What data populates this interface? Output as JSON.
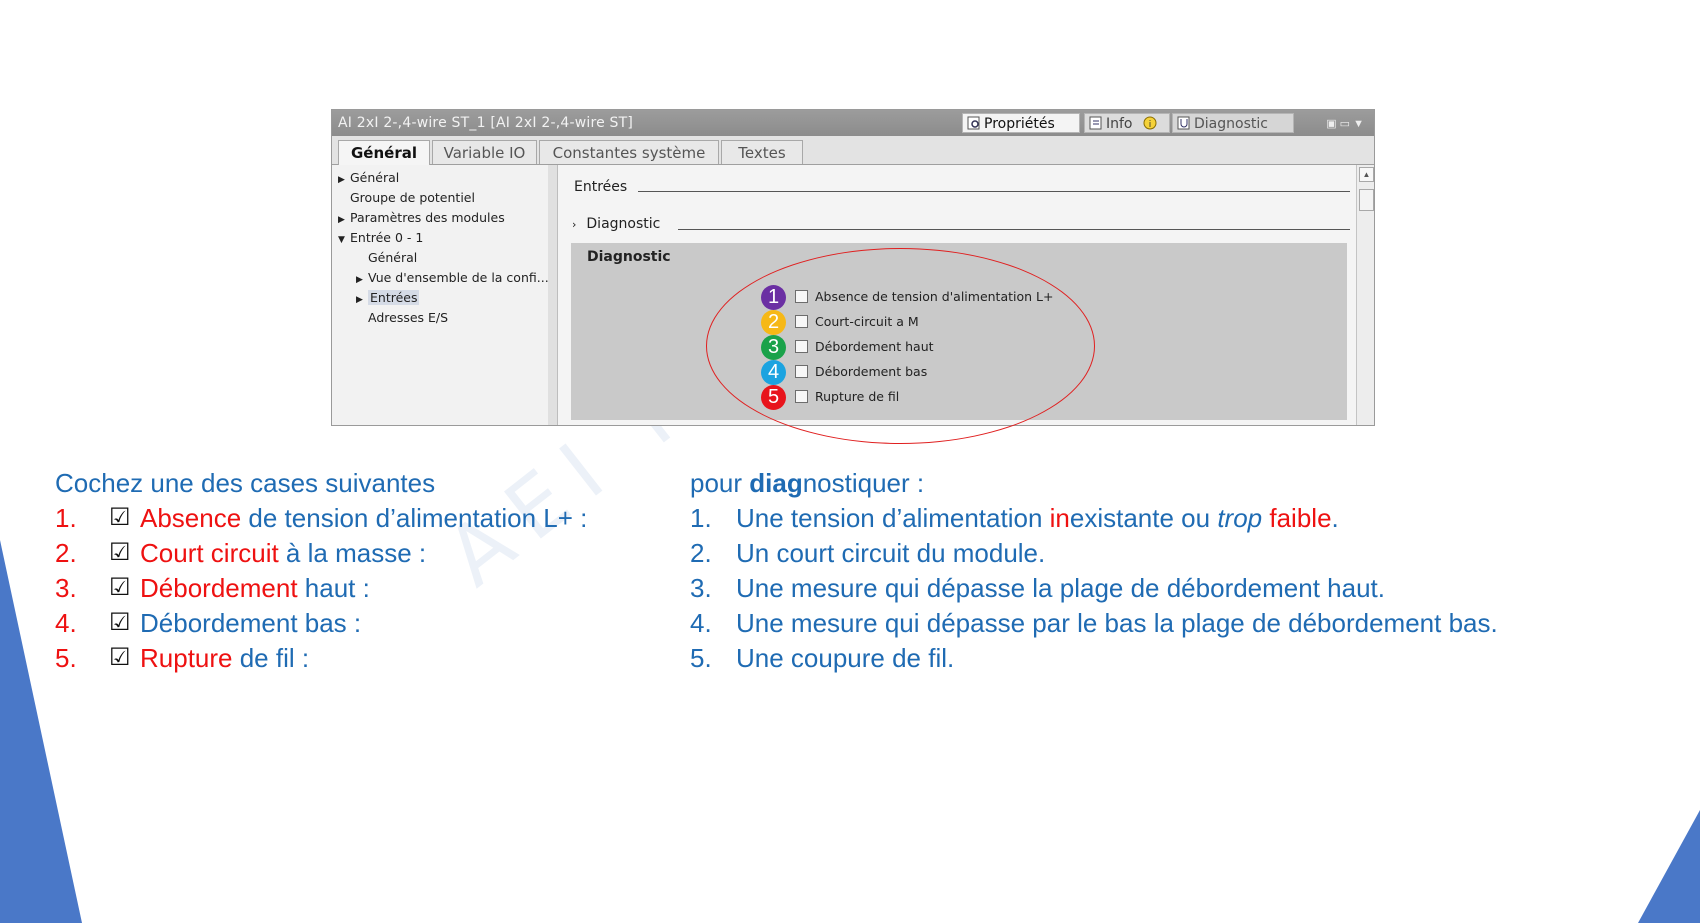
{
  "window": {
    "title": "AI 2xI 2-,4-wire ST_1 [AI 2xI 2-,4-wire ST]",
    "tabs_right": [
      "Propriétés",
      "Info",
      "Diagnostic"
    ]
  },
  "tabs": [
    "Général",
    "Variable IO",
    "Constantes système",
    "Textes"
  ],
  "tree": [
    "Général",
    "Groupe de potentiel",
    "Paramètres des modules",
    "Entrée 0 - 1",
    "Général",
    "Vue d'ensemble de la confi...",
    "Entrées",
    "Adresses E/S"
  ],
  "content": {
    "section1": "Entrées",
    "section2": "Diagnostic",
    "box_title": "Diagnostic",
    "checkboxes": [
      {
        "num": "1",
        "label": "Absence de tension d'alimentation L+",
        "color": "#6b2fa3"
      },
      {
        "num": "2",
        "label": "Court-circuit a M",
        "color": "#f6b817"
      },
      {
        "num": "3",
        "label": "Débordement haut",
        "color": "#1aa24a"
      },
      {
        "num": "4",
        "label": "Débordement bas",
        "color": "#1ba3e0"
      },
      {
        "num": "5",
        "label": "Rupture de fil",
        "color": "#e8141c"
      }
    ]
  },
  "left_text": {
    "intro": "Cochez une des cases suivantes",
    "items": [
      {
        "num": "1.",
        "check": "☑",
        "red": "Absence",
        "rest": " de tension d’alimentation L+ :"
      },
      {
        "num": "2.",
        "check": "☑",
        "red": "Court circuit",
        "rest": " à la masse :"
      },
      {
        "num": "3.",
        "check": "☑",
        "red": "Débordement",
        "rest": " haut :"
      },
      {
        "num": "4.",
        "check": "☑",
        "red": "",
        "rest": "Débordement bas :"
      },
      {
        "num": "5.",
        "check": "☑",
        "red": "Rupture",
        "rest": " de fil :"
      }
    ]
  },
  "right_text": {
    "intro_pre": "pour ",
    "intro_bold": "diag",
    "intro_post": "nostiquer :",
    "items": [
      {
        "num": "1.",
        "a": "Une tension d’alimentation ",
        "b": "in",
        "c": "existante ou ",
        "d": "trop",
        "e": " ",
        "f": "faible",
        "g": "."
      },
      {
        "num": "2.",
        "text": "Un court circuit du module."
      },
      {
        "num": "3.",
        "text": "Une mesure qui dépasse la plage de débordement haut."
      },
      {
        "num": "4.",
        "text": "Une mesure qui dépasse par le bas la plage de débordement bas."
      },
      {
        "num": "5.",
        "text": "Une coupure de fil."
      }
    ]
  },
  "watermark": "AEI FORMATI",
  "colors": {
    "accent_blue": "#1f6bb3",
    "accent_red": "#ee1111",
    "slide_shape": "#4a78c8"
  }
}
